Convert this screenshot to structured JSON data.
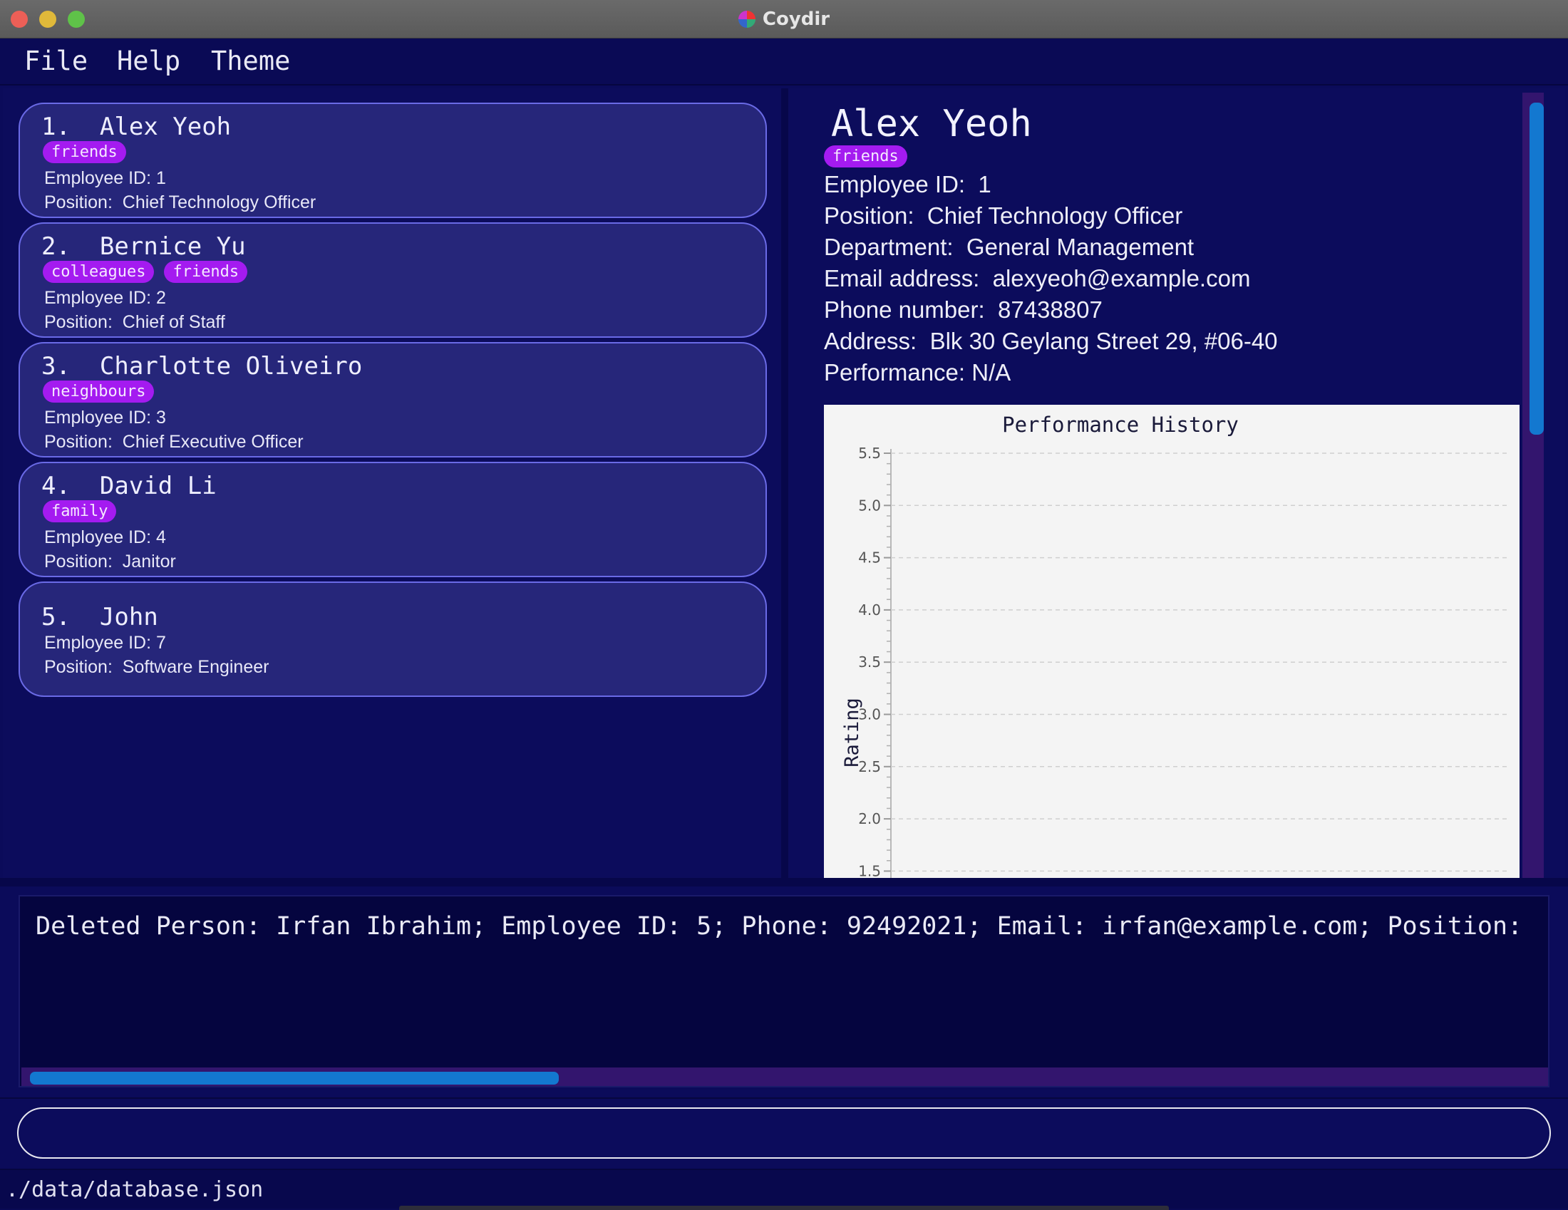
{
  "window": {
    "title": "Coydir"
  },
  "menu": {
    "file": "File",
    "help": "Help",
    "theme": "Theme"
  },
  "persons": [
    {
      "index": "1.",
      "name": "Alex Yeoh",
      "tags": [
        "friends"
      ],
      "employee_id_label": "Employee ID:",
      "employee_id": "1",
      "position_label": "Position:",
      "position": "Chief Technology Officer"
    },
    {
      "index": "2.",
      "name": "Bernice Yu",
      "tags": [
        "colleagues",
        "friends"
      ],
      "employee_id_label": "Employee ID:",
      "employee_id": "2",
      "position_label": "Position:",
      "position": "Chief of Staff"
    },
    {
      "index": "3.",
      "name": "Charlotte Oliveiro",
      "tags": [
        "neighbours"
      ],
      "employee_id_label": "Employee ID:",
      "employee_id": "3",
      "position_label": "Position:",
      "position": "Chief Executive Officer"
    },
    {
      "index": "4.",
      "name": "David Li",
      "tags": [
        "family"
      ],
      "employee_id_label": "Employee ID:",
      "employee_id": "4",
      "position_label": "Position:",
      "position": "Janitor"
    },
    {
      "index": "5.",
      "name": "John",
      "tags": [],
      "employee_id_label": "Employee ID:",
      "employee_id": "7",
      "position_label": "Position:",
      "position": "Software Engineer"
    }
  ],
  "detail": {
    "name": "Alex Yeoh",
    "tags": [
      "friends"
    ],
    "employee_id": "Employee ID:  1",
    "position": "Position:  Chief Technology Officer",
    "department": "Department:  General Management",
    "email": "Email address:  alexyeoh@example.com",
    "phone": "Phone number:  87438807",
    "address": "Address:  Blk 30 Geylang Street 29, #06-40",
    "performance": "Performance: N/A"
  },
  "chart_data": {
    "type": "line",
    "title": "Performance History",
    "xlabel": "",
    "ylabel": "Rating",
    "ylim": [
      1.5,
      5.5
    ],
    "y_ticks": [
      "5.5",
      "5.0",
      "4.5",
      "4.0",
      "3.5",
      "3.0",
      "2.5",
      "2.0",
      "1.5"
    ],
    "grid": true,
    "series": []
  },
  "result": {
    "text": "Deleted Person: Irfan Ibrahim; Employee ID: 5; Phone: 92492021; Email: irfan@example.com; Position:"
  },
  "command": {
    "value": "",
    "placeholder": ""
  },
  "status": {
    "path": "./data/database.json"
  },
  "colors": {
    "accent": "#1378d0",
    "tag": "#a41bf0",
    "card": "#26267a",
    "background": "#0b0b5a"
  }
}
